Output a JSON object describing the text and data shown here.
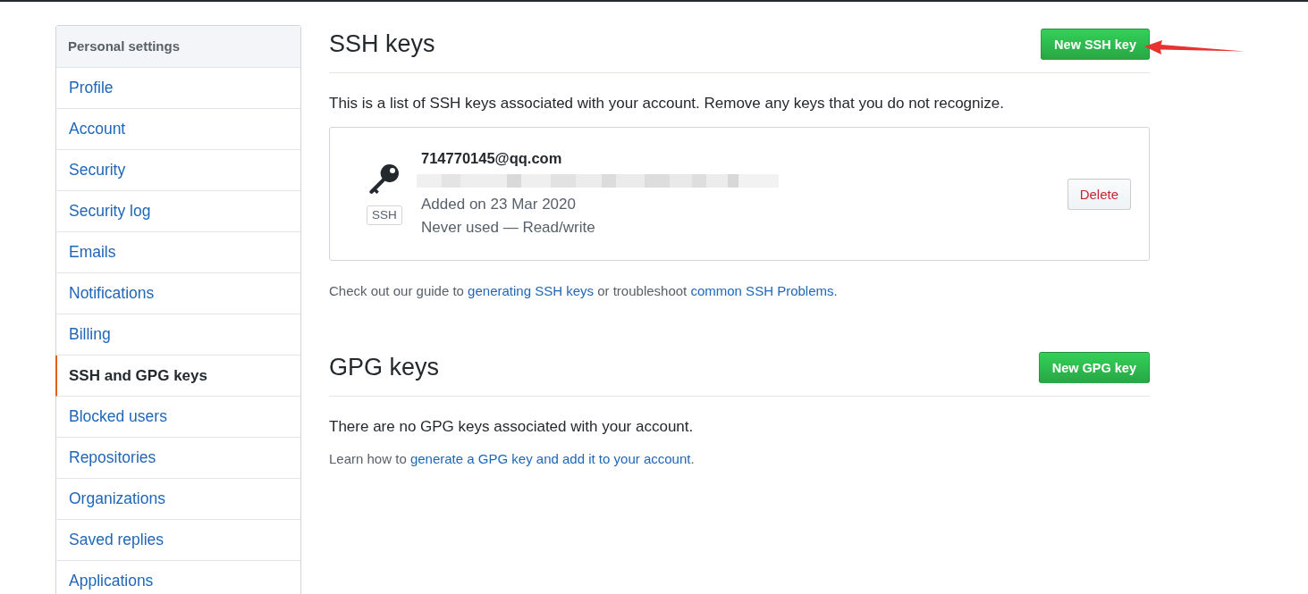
{
  "sidebar": {
    "heading": "Personal settings",
    "items": [
      {
        "label": "Profile",
        "selected": false
      },
      {
        "label": "Account",
        "selected": false
      },
      {
        "label": "Security",
        "selected": false
      },
      {
        "label": "Security log",
        "selected": false
      },
      {
        "label": "Emails",
        "selected": false
      },
      {
        "label": "Notifications",
        "selected": false
      },
      {
        "label": "Billing",
        "selected": false
      },
      {
        "label": "SSH and GPG keys",
        "selected": true
      },
      {
        "label": "Blocked users",
        "selected": false
      },
      {
        "label": "Repositories",
        "selected": false
      },
      {
        "label": "Organizations",
        "selected": false
      },
      {
        "label": "Saved replies",
        "selected": false
      },
      {
        "label": "Applications",
        "selected": false
      }
    ]
  },
  "ssh_keys": {
    "title": "SSH keys",
    "new_button": "New SSH key",
    "pointer_arrow": true,
    "description": "This is a list of SSH keys associated with your account. Remove any keys that you do not recognize.",
    "keys": [
      {
        "title": "714770145@qq.com",
        "type_label": "SSH",
        "fingerprint_blurred": true,
        "added": "Added on 23 Mar 2020",
        "usage": "Never used — Read/write",
        "delete_button": "Delete"
      }
    ],
    "help": [
      {
        "kind": "text",
        "text": "Check out our guide to "
      },
      {
        "kind": "link",
        "text": "generating SSH keys"
      },
      {
        "kind": "text",
        "text": " or troubleshoot "
      },
      {
        "kind": "link",
        "text": "common SSH Problems"
      },
      {
        "kind": "text",
        "text": "."
      }
    ]
  },
  "gpg_keys": {
    "title": "GPG keys",
    "new_button": "New GPG key",
    "empty_message": "There are no GPG keys associated with your account.",
    "help": [
      {
        "kind": "text",
        "text": "Learn how to "
      },
      {
        "kind": "link",
        "text": "generate a GPG key and add it to your account"
      },
      {
        "kind": "text",
        "text": "."
      }
    ]
  }
}
